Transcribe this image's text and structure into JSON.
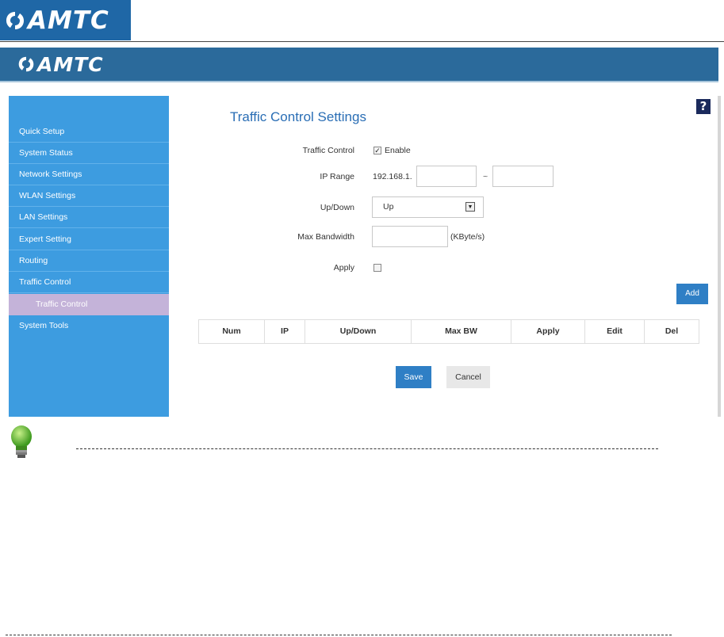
{
  "brand": {
    "name": "AMTC",
    "color": "#1f67a6",
    "banner_color": "#2b6a9b"
  },
  "sidebar": {
    "items": [
      {
        "label": "Quick Setup"
      },
      {
        "label": "System Status"
      },
      {
        "label": "Network Settings"
      },
      {
        "label": "WLAN Settings"
      },
      {
        "label": "LAN Settings"
      },
      {
        "label": "Expert Setting"
      },
      {
        "label": "Routing"
      },
      {
        "label": "Traffic Control"
      },
      {
        "label": "Traffic Control",
        "sub": true,
        "active": true
      },
      {
        "label": "System Tools"
      }
    ]
  },
  "main": {
    "title": "Traffic Control Settings",
    "help_icon": "?",
    "traffic_control": {
      "label": "Traffic Control",
      "checked": true,
      "option_text": "Enable"
    },
    "ip_range": {
      "label": "IP Range",
      "prefix": "192.168.1.",
      "start_value": "",
      "separator": "~",
      "end_value": ""
    },
    "up_down": {
      "label": "Up/Down",
      "selected": "Up",
      "arrow_icon": "dropdown-arrow-icon"
    },
    "max_bandwidth": {
      "label": "Max Bandwidth",
      "value": "",
      "unit": "(KByte/s)"
    },
    "apply": {
      "label": "Apply",
      "checked": false
    },
    "add_button": "Add",
    "table": {
      "headers": [
        "Num",
        "IP",
        "Up/Down",
        "Max BW",
        "Apply",
        "Edit",
        "Del"
      ]
    },
    "save_button": "Save",
    "cancel_button": "Cancel"
  },
  "tip": {
    "icon": "lightbulb-icon"
  }
}
